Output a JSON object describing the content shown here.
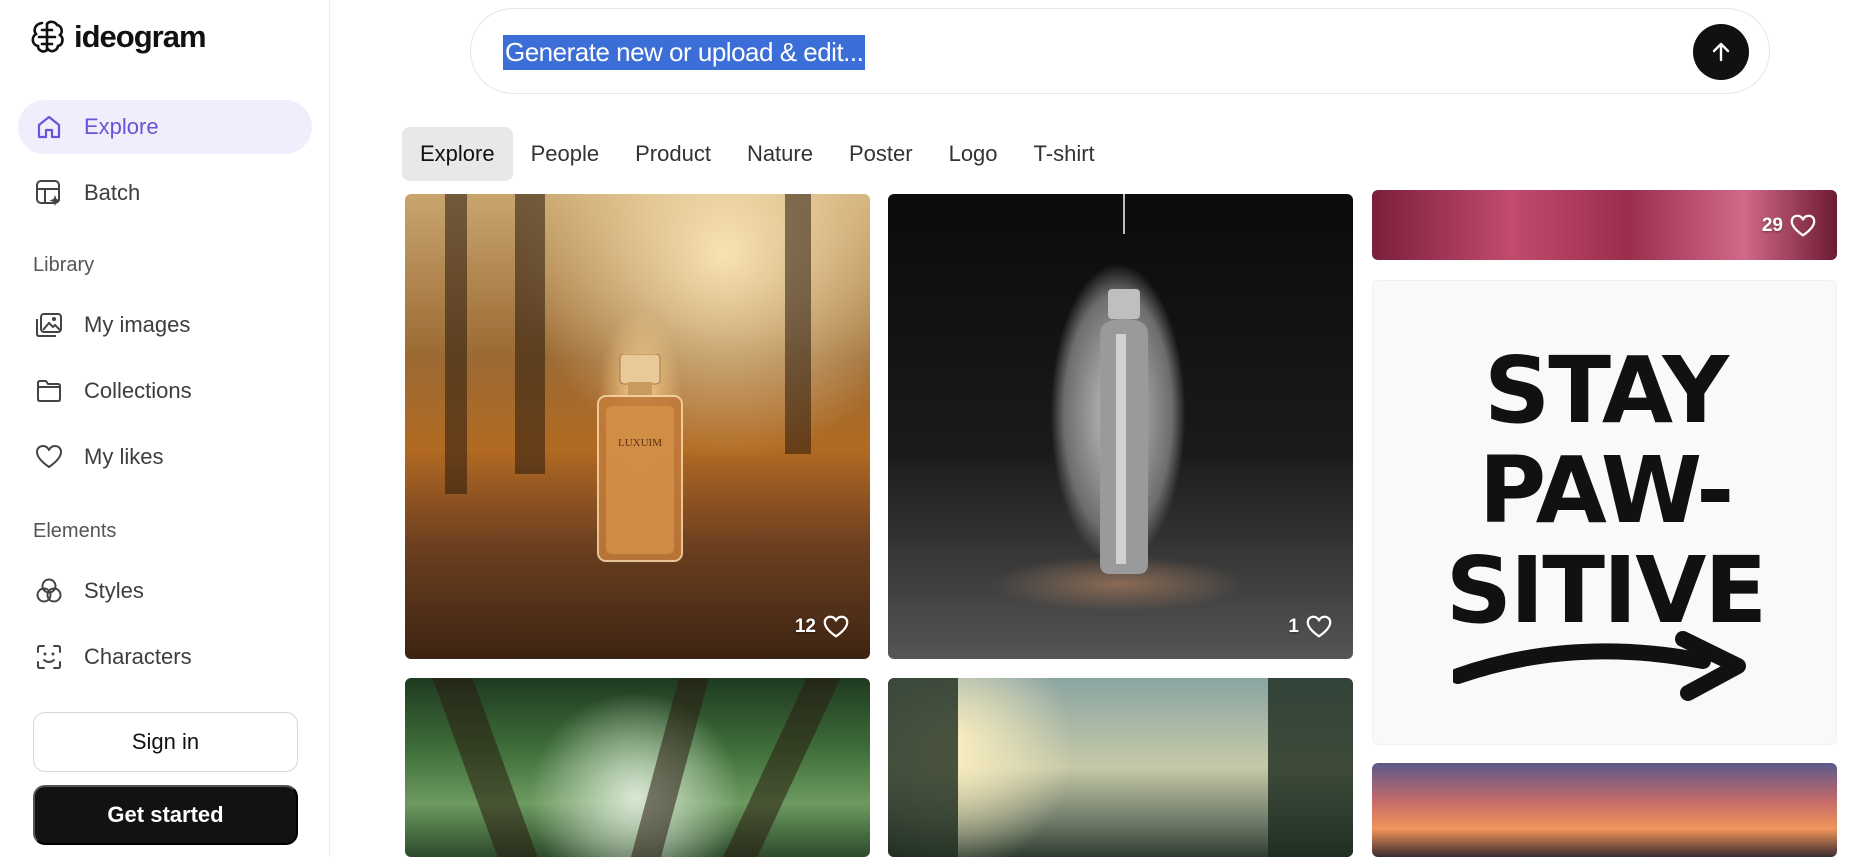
{
  "brand": {
    "name": "ideogram"
  },
  "sidebar": {
    "nav": [
      {
        "label": "Explore",
        "icon": "home-icon",
        "active": true
      },
      {
        "label": "Batch",
        "icon": "batch-icon",
        "active": false
      }
    ],
    "library_label": "Library",
    "library": [
      {
        "label": "My images",
        "icon": "images-icon"
      },
      {
        "label": "Collections",
        "icon": "folder-icon"
      },
      {
        "label": "My likes",
        "icon": "heart-icon"
      }
    ],
    "elements_label": "Elements",
    "elements": [
      {
        "label": "Styles",
        "icon": "styles-icon"
      },
      {
        "label": "Characters",
        "icon": "characters-icon"
      }
    ],
    "sign_in": "Sign in",
    "get_started": "Get started"
  },
  "prompt": {
    "placeholder": "Generate new or upload & edit...",
    "send_icon": "arrow-up-icon"
  },
  "tabs": [
    {
      "label": "Explore",
      "active": true
    },
    {
      "label": "People",
      "active": false
    },
    {
      "label": "Product",
      "active": false
    },
    {
      "label": "Nature",
      "active": false
    },
    {
      "label": "Poster",
      "active": false
    },
    {
      "label": "Logo",
      "active": false
    },
    {
      "label": "T-shirt",
      "active": false
    }
  ],
  "gallery": {
    "perfume": {
      "likes": "12",
      "label_text": "LUXUIM"
    },
    "bottle": {
      "likes": "1"
    },
    "pink": {
      "likes": "29"
    },
    "stay": {
      "lines": [
        "STAY",
        "PAW-",
        "SITIVE"
      ]
    }
  },
  "colors": {
    "accent": "#6a53d6",
    "accent_bg": "#f0eefc",
    "selection": "#3b6ed6",
    "dark_button": "#121212"
  }
}
